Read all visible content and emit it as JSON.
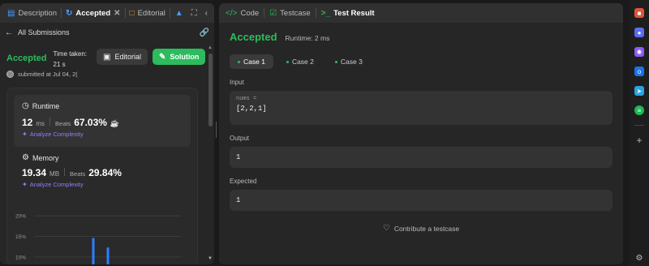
{
  "left_tabs": {
    "description": "Description",
    "accepted": "Accepted",
    "editorial": "Editorial"
  },
  "back": {
    "label": "All Submissions"
  },
  "submission": {
    "status": "Accepted",
    "time_taken_label": "Time taken:",
    "time_taken_value": "21 s",
    "editorial_btn": "Editorial",
    "solution_btn": "Solution",
    "submitted_text": "submitted at Jul 04, 2("
  },
  "runtime_card": {
    "title": "Runtime",
    "value": "12",
    "unit": "ms",
    "beats_label": "Beats",
    "beats_pct": "67.03%",
    "analyze": "Analyze Complexity"
  },
  "memory_card": {
    "title": "Memory",
    "value": "19.34",
    "unit": "MB",
    "beats_label": "Beats",
    "beats_pct": "29.84%",
    "analyze": "Analyze Complexity"
  },
  "chart_data": {
    "type": "bar",
    "ytick_labels": [
      "20%",
      "15%",
      "10%"
    ],
    "ylim": [
      8,
      21
    ],
    "bars": [
      {
        "x": 0.4,
        "value": 14.6
      },
      {
        "x": 0.5,
        "value": 12.3
      }
    ],
    "bar_color": "#2b7fff"
  },
  "right_tabs": {
    "code": "Code",
    "testcase": "Testcase",
    "test_result": "Test Result"
  },
  "result": {
    "status": "Accepted",
    "runtime": "Runtime: 2 ms",
    "cases": [
      "Case 1",
      "Case 2",
      "Case 3"
    ],
    "input_label": "Input",
    "input_var": "nums =",
    "input_value": "[2,2,1]",
    "output_label": "Output",
    "output_value": "1",
    "expected_label": "Expected",
    "expected_value": "1",
    "contribute": "Contribute a testcase"
  },
  "colors": {
    "accent_green": "#2cbb5d",
    "purple": "#9b7bff",
    "bar_blue": "#2b7fff"
  }
}
